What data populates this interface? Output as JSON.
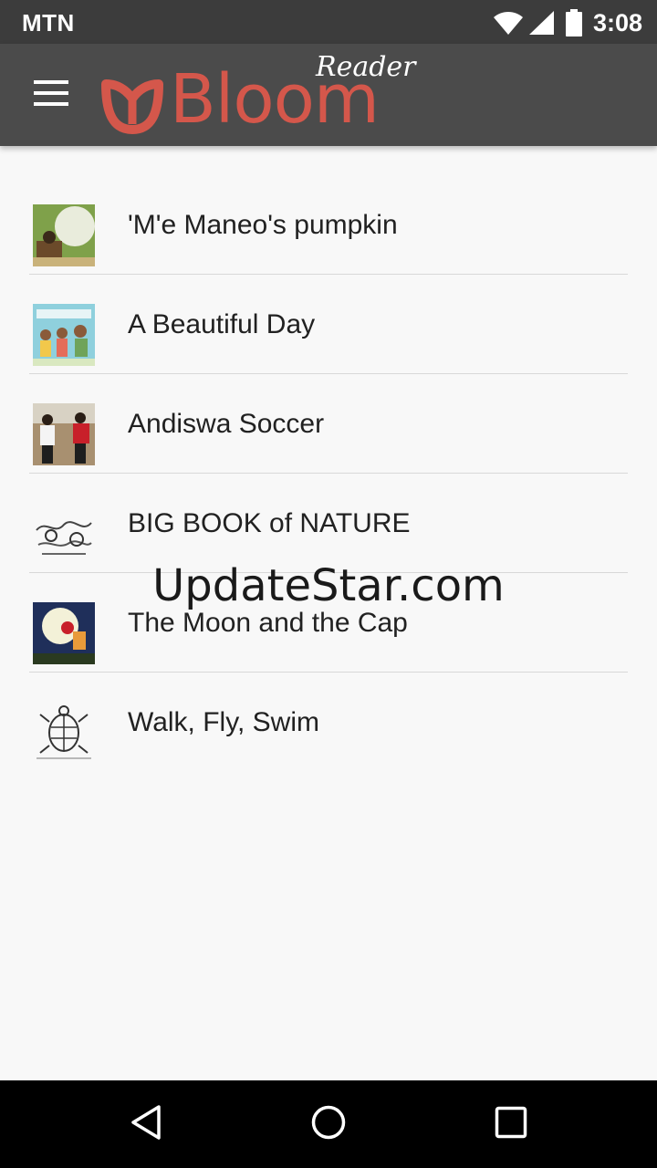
{
  "status_bar": {
    "carrier": "MTN",
    "time": "3:08",
    "icons": [
      "wifi-icon",
      "cell-signal-icon",
      "battery-icon"
    ]
  },
  "app_bar": {
    "logo_word": "Bloom",
    "logo_reader": "Reader",
    "icons": [
      "menu-icon",
      "bloom-flower-logo"
    ],
    "background_color": "#4b4b4b",
    "logo_color": "#d4574b"
  },
  "books": [
    {
      "title": "'M'e Maneo's pumpkin"
    },
    {
      "title": "A Beautiful Day"
    },
    {
      "title": "Andiswa Soccer"
    },
    {
      "title": "BIG BOOK of NATURE"
    },
    {
      "title": "The Moon and the Cap"
    },
    {
      "title": "Walk, Fly, Swim"
    }
  ],
  "watermark": "UpdateStar.com",
  "nav_bar": {
    "icons": [
      "back-icon",
      "home-icon",
      "recents-icon"
    ]
  }
}
